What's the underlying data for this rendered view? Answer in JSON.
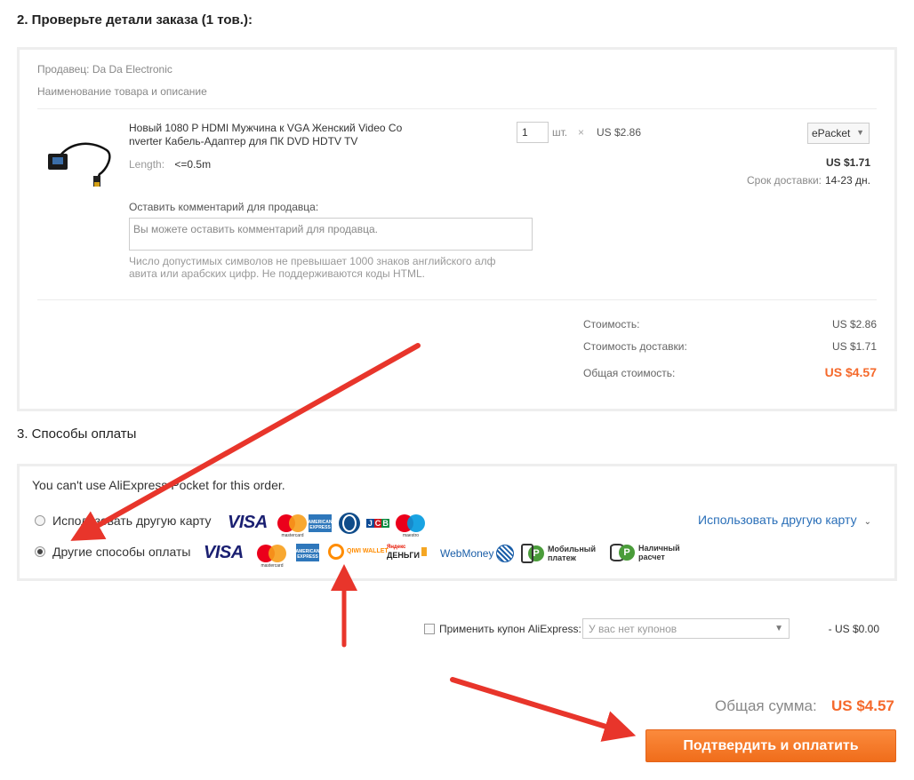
{
  "step2": {
    "title": "2. Проверьте детали заказа (1 тов.):",
    "seller": "Продавец: Da Da Electronic",
    "product_header": "Наименование товара и описание",
    "product": {
      "title": "Новый 1080 P HDMI Мужчина к VGA Женский Video Co nverter Кабель-Адаптер для ПК DVD HDTV TV",
      "attr_key": "Length:",
      "attr_value": "<=0.5m",
      "quantity": "1",
      "unit": "шт.",
      "times": "×",
      "unit_price": "US $2.86",
      "shipping_method": "ePacket",
      "shipping_price": "US $1.71",
      "delivery_label": "Срок доставки:",
      "delivery_value": "14-23 дн."
    },
    "comment": {
      "label": "Оставить комментарий для продавца:",
      "placeholder": "Вы можете оставить комментарий для продавца.",
      "hint": "Число допустимых символов не превышает 1000 знаков английского алф авита или арабских цифр. Не поддерживаются коды HTML."
    },
    "summary": {
      "cost_label": "Стоимость:",
      "cost_value": "US $2.86",
      "shipping_label": "Стоимость доставки:",
      "shipping_value": "US $1.71",
      "total_label": "Общая стоимость:",
      "total_value": "US $4.57"
    }
  },
  "step3": {
    "title": "3. Способы оплаты",
    "pocket_message": "You can't use AliExpress Pocket for this order.",
    "option_card_label": "Использовать другую карту",
    "option_other_label": "Другие способы оплаты",
    "other_card_link": "Использовать другую карту",
    "logos": {
      "visa": "VISA",
      "mastercard_text": "mastercard",
      "maestro_text": "maestro",
      "amex_text": "AMERICAN EXPRESS",
      "jcb": [
        "J",
        "C",
        "B"
      ],
      "qiwi": "QIWI WALLET",
      "yandex_top": "Яндекс",
      "yandex_main": "ДЕНЬГИ",
      "webmoney": "WebMoney",
      "mobile": "Мобильный платеж",
      "cash": "Наличный расчет",
      "ruble": "Р"
    }
  },
  "coupon": {
    "label": "Применить купон AliExpress:",
    "select_value": "У вас нет купонов",
    "amount": "- US $0.00"
  },
  "grand_total": {
    "label": "Общая сумма:",
    "value": "US $4.57"
  },
  "pay_button": "Подтвердить и оплатить",
  "colors": {
    "accent_orange": "#f5692b",
    "link_blue": "#2a6fb8",
    "arrow_red": "#e8352b"
  }
}
